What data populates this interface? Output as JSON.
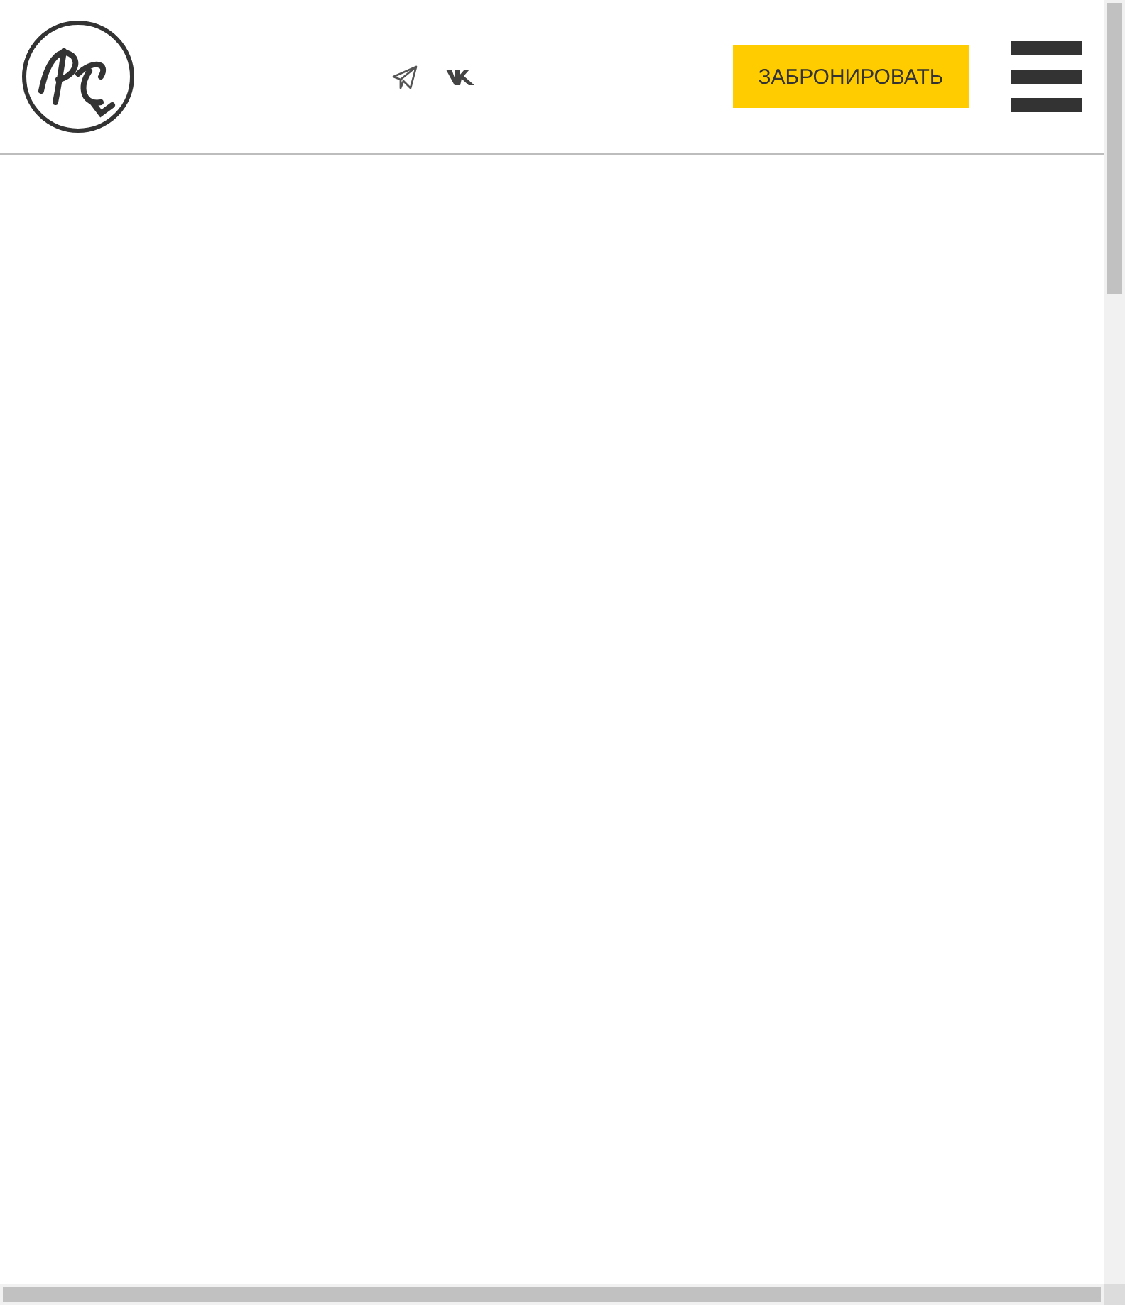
{
  "header": {
    "book_button": "ЗАБРОНИРОВАТЬ"
  }
}
